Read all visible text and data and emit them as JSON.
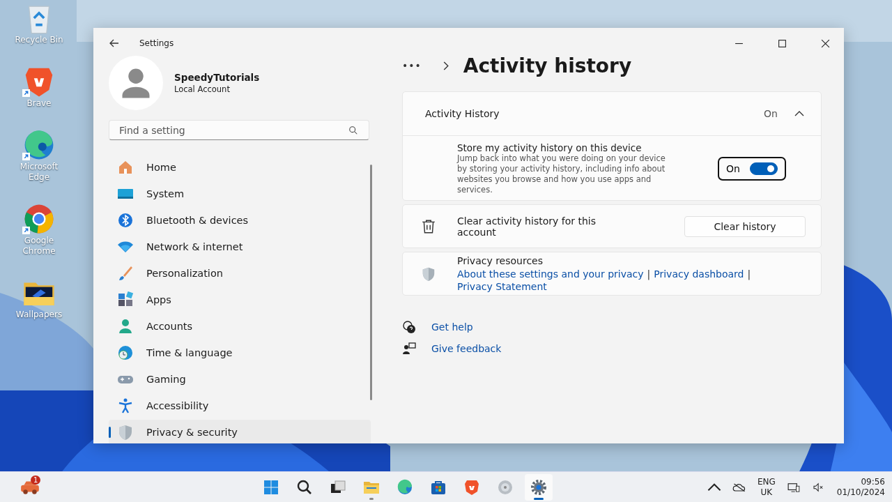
{
  "desktop_icons": [
    {
      "label": "Recycle Bin",
      "kind": "recycle",
      "shortcut": false
    },
    {
      "label": "Brave",
      "kind": "brave",
      "shortcut": true
    },
    {
      "label": "Microsoft Edge",
      "kind": "edge",
      "shortcut": true
    },
    {
      "label": "Google Chrome",
      "kind": "chrome",
      "shortcut": true
    },
    {
      "label": "Wallpapers",
      "kind": "folder",
      "shortcut": false
    }
  ],
  "window": {
    "title": "Settings"
  },
  "account": {
    "name": "SpeedyTutorials",
    "type": "Local Account"
  },
  "search": {
    "placeholder": "Find a setting"
  },
  "nav": [
    {
      "label": "Home",
      "kind": "home",
      "selected": false
    },
    {
      "label": "System",
      "kind": "system",
      "selected": false
    },
    {
      "label": "Bluetooth & devices",
      "kind": "bluetooth",
      "selected": false
    },
    {
      "label": "Network & internet",
      "kind": "network",
      "selected": false
    },
    {
      "label": "Personalization",
      "kind": "brush",
      "selected": false
    },
    {
      "label": "Apps",
      "kind": "apps",
      "selected": false
    },
    {
      "label": "Accounts",
      "kind": "accounts",
      "selected": false
    },
    {
      "label": "Time & language",
      "kind": "time",
      "selected": false
    },
    {
      "label": "Gaming",
      "kind": "gaming",
      "selected": false
    },
    {
      "label": "Accessibility",
      "kind": "accessibility",
      "selected": false
    },
    {
      "label": "Privacy & security",
      "kind": "shield",
      "selected": true
    }
  ],
  "breadcrumb": {
    "more": "•••",
    "title": "Activity history"
  },
  "activity": {
    "title": "Activity History",
    "status": "On",
    "expanded": true,
    "setting": {
      "title": "Store my activity history on this device",
      "description": "Jump back into what you were doing on your device by storing your activity history, including info about websites you browse and how you use apps and services.",
      "toggle_label": "On",
      "on": true
    }
  },
  "clear": {
    "label": "Clear activity history for this account",
    "button": "Clear history"
  },
  "privacy": {
    "title": "Privacy resources",
    "separator": "|",
    "links": [
      "About these settings and your privacy",
      "Privacy dashboard",
      "Privacy Statement"
    ]
  },
  "help": [
    {
      "label": "Get help",
      "kind": "help"
    },
    {
      "label": "Give feedback",
      "kind": "feedback"
    }
  ],
  "taskbar": {
    "widget_badge": "1",
    "apps": [
      {
        "kind": "start",
        "selected": false,
        "running": false
      },
      {
        "kind": "search",
        "selected": false,
        "running": false
      },
      {
        "kind": "taskview",
        "selected": false,
        "running": false
      },
      {
        "kind": "explorer",
        "selected": false,
        "running": true
      },
      {
        "kind": "edge",
        "selected": false,
        "running": false
      },
      {
        "kind": "store",
        "selected": false,
        "running": false
      },
      {
        "kind": "brave",
        "selected": false,
        "running": false
      },
      {
        "kind": "disc",
        "selected": false,
        "running": false
      },
      {
        "kind": "settings",
        "selected": true,
        "running": true
      }
    ],
    "language": "ENG",
    "region": "UK",
    "time": "09:56",
    "date": "01/10/2024"
  }
}
